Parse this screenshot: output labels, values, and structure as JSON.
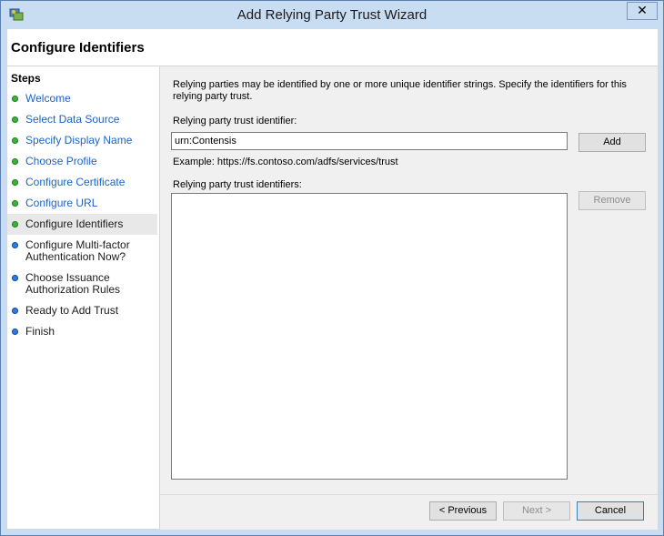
{
  "window": {
    "title": "Add Relying Party Trust Wizard",
    "close_glyph": "✕"
  },
  "header": {
    "title": "Configure Identifiers"
  },
  "steps": {
    "heading": "Steps",
    "items": [
      {
        "label": "Welcome",
        "status": "done"
      },
      {
        "label": "Select Data Source",
        "status": "done"
      },
      {
        "label": "Specify Display Name",
        "status": "done"
      },
      {
        "label": "Choose Profile",
        "status": "done"
      },
      {
        "label": "Configure Certificate",
        "status": "done"
      },
      {
        "label": "Configure URL",
        "status": "done"
      },
      {
        "label": "Configure Identifiers",
        "status": "current"
      },
      {
        "label": "Configure Multi-factor Authentication Now?",
        "status": "pending"
      },
      {
        "label": "Choose Issuance Authorization Rules",
        "status": "pending"
      },
      {
        "label": "Ready to Add Trust",
        "status": "pending"
      },
      {
        "label": "Finish",
        "status": "pending"
      }
    ]
  },
  "main": {
    "description": "Relying parties may be identified by one or more unique identifier strings. Specify the identifiers for this relying party trust.",
    "identifier_label": "Relying party trust identifier:",
    "identifier_value": "urn:Contensis",
    "add_label": "Add",
    "example_text": "Example: https://fs.contoso.com/adfs/services/trust",
    "identifiers_label": "Relying party trust identifiers:",
    "identifiers": [],
    "remove_label": "Remove"
  },
  "footer": {
    "previous_label": "< Previous",
    "next_label": "Next >",
    "cancel_label": "Cancel"
  },
  "colors": {
    "done_dot": "#3bb33b",
    "pending_dot": "#2d7be0",
    "link": "#1a64c8"
  }
}
